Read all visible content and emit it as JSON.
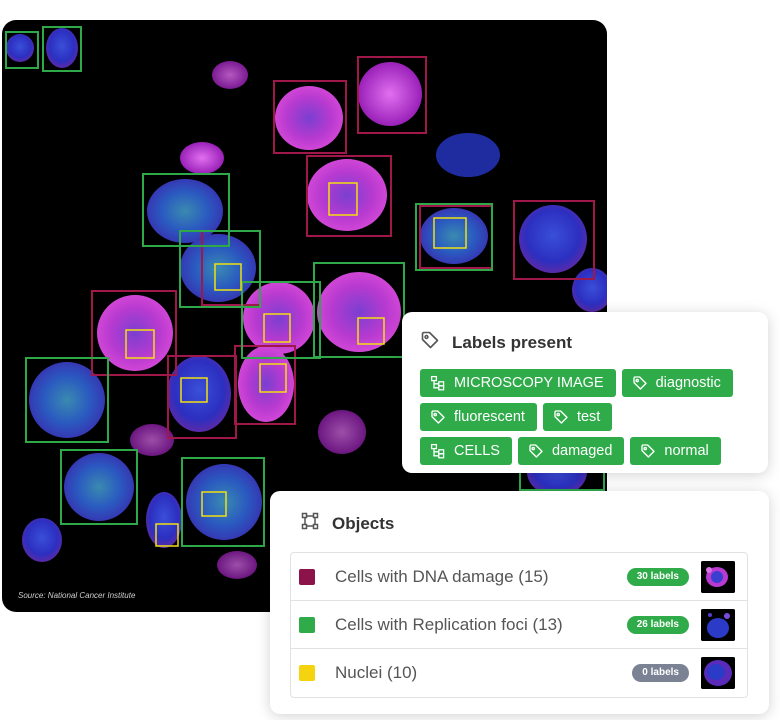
{
  "image": {
    "source_caption": "Source: National Cancer Institute",
    "box_colors": {
      "dna_damage": "#a0184a",
      "replication_foci": "#2fa84a",
      "nuclei": "#f1e011"
    }
  },
  "labels_panel": {
    "title": "Labels present",
    "title_icon": "tag-icon",
    "rows": [
      [
        {
          "text": "MICROSCOPY IMAGE",
          "icon": "hierarchy-icon"
        },
        {
          "text": "diagnostic",
          "icon": "tag-icon"
        }
      ],
      [
        {
          "text": "fluorescent",
          "icon": "tag-icon"
        },
        {
          "text": "test",
          "icon": "tag-icon"
        }
      ],
      [
        {
          "text": "CELLS",
          "icon": "hierarchy-icon"
        },
        {
          "text": "damaged",
          "icon": "tag-icon"
        },
        {
          "text": "normal",
          "icon": "tag-icon"
        }
      ]
    ],
    "tag_color": "#2fab4a"
  },
  "objects_panel": {
    "title": "Objects",
    "title_icon": "bounding-box-icon",
    "items": [
      {
        "name": "Cells with DNA damage (15)",
        "color": "#8b1349",
        "labels": "30 labels",
        "pill_color": "#2fab4a",
        "thumb": "magenta-cell"
      },
      {
        "name": "Cells with Replication foci (13)",
        "color": "#2fab4a",
        "labels": "26 labels",
        "pill_color": "#2fab4a",
        "thumb": "blue-cell"
      },
      {
        "name": "Nuclei (10)",
        "color": "#f5d40f",
        "labels": "0 labels",
        "pill_color": "#7a8294",
        "thumb": "purple-cell"
      }
    ]
  }
}
